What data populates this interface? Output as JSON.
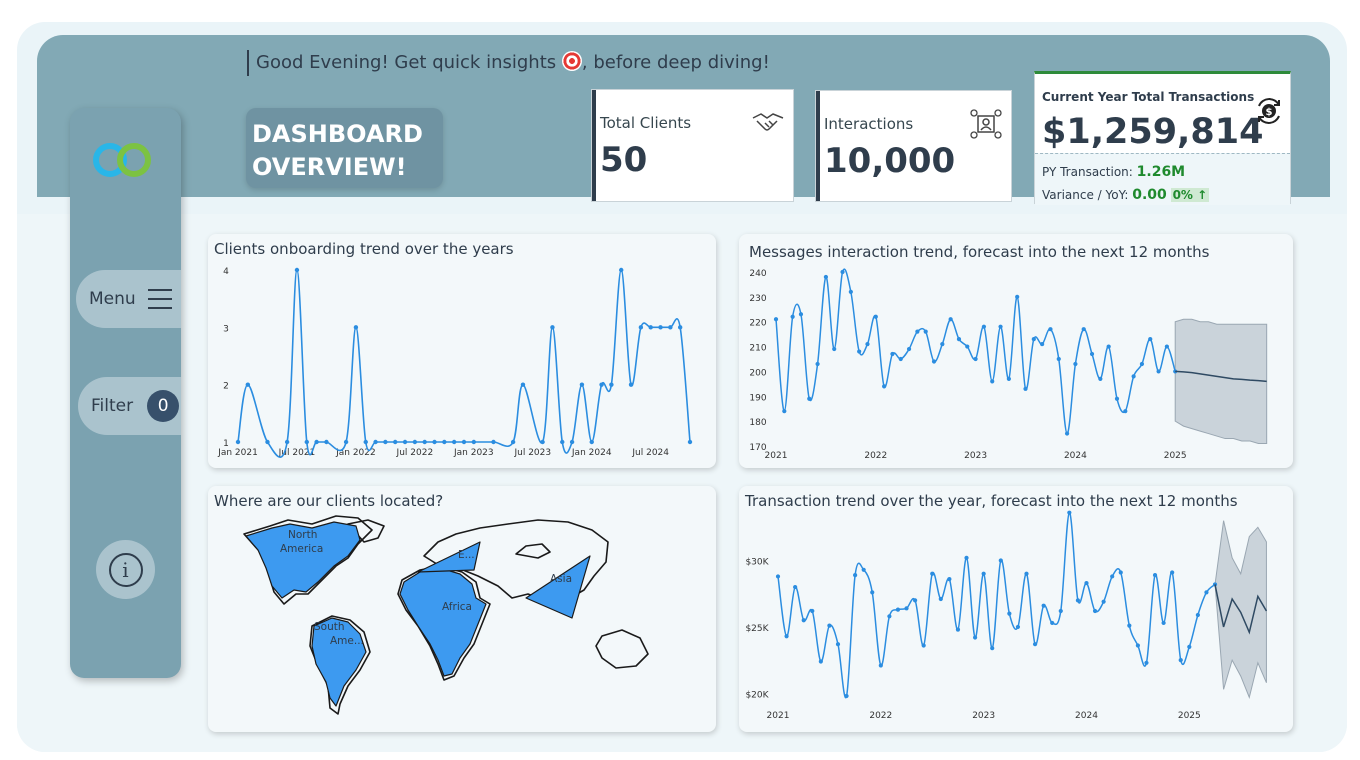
{
  "greeting": {
    "text_before": "Good Evening! Get quick insights",
    "text_after": ", before deep diving!"
  },
  "title": {
    "line1": "DASHBOARD",
    "line2": "OVERVIEW!"
  },
  "sidebar": {
    "menu_label": "Menu",
    "filter_label": "Filter",
    "filter_count": "0",
    "info_glyph": "i"
  },
  "kpis": {
    "clients": {
      "label": "Total Clients",
      "value": "50",
      "icon": "handshake-icon"
    },
    "interactions": {
      "label": "Interactions",
      "value": "10,000",
      "icon": "network-icon"
    },
    "transactions": {
      "label": "Current Year Total Transactions",
      "value": "$1,259,814",
      "icon": "dollar-refresh-icon",
      "py_label": "PY Transaction:",
      "py_value": "1.26M",
      "variance_label": "Variance / YoY:",
      "variance_value": "0.00",
      "variance_pct": "0%"
    }
  },
  "colors": {
    "header": "#82a9b5",
    "sidebar": "#7ba2b0",
    "line": "#2b8de0",
    "forecast": "#2f4a63",
    "map_fill": "#3d9af0",
    "accent_green": "#1f8a2e",
    "dark_text": "#2f3d4c"
  },
  "chart_data": [
    {
      "type": "line",
      "title": "Clients onboarding trend over the years",
      "x": [
        "2021-01",
        "2021-02",
        "2021-04",
        "2021-06",
        "2021-07",
        "2021-08",
        "2021-09",
        "2021-10",
        "2021-12",
        "2022-01",
        "2022-02",
        "2022-03",
        "2022-04",
        "2022-05",
        "2022-06",
        "2022-07",
        "2022-08",
        "2022-09",
        "2022-10",
        "2022-11",
        "2022-12",
        "2023-01",
        "2023-03",
        "2023-05",
        "2023-06",
        "2023-08",
        "2023-09",
        "2023-10",
        "2023-11",
        "2023-12",
        "2024-01",
        "2024-02",
        "2024-03",
        "2024-04",
        "2024-05",
        "2024-06",
        "2024-07",
        "2024-08",
        "2024-09",
        "2024-10",
        "2024-11"
      ],
      "values": [
        1,
        2,
        1,
        1,
        4,
        1,
        1,
        1,
        1,
        3,
        1,
        1,
        1,
        1,
        1,
        1,
        1,
        1,
        1,
        1,
        1,
        1,
        1,
        1,
        2,
        1,
        3,
        1,
        1,
        2,
        1,
        2,
        2,
        4,
        2,
        3,
        3,
        3,
        3,
        3,
        1
      ],
      "x_ticks": [
        "Jan 2021",
        "Jul 2021",
        "Jan 2022",
        "Jul 2022",
        "Jan 2023",
        "Jul 2023",
        "Jan 2024",
        "Jul 2024"
      ],
      "y_ticks": [
        "1",
        "2",
        "3",
        "4"
      ],
      "ylim": [
        1,
        4
      ]
    },
    {
      "type": "line",
      "title": "Messages interaction trend, forecast into the next 12 months",
      "x_ticks": [
        "2021",
        "2022",
        "2023",
        "2024",
        "2025"
      ],
      "y_ticks": [
        "170",
        "180",
        "190",
        "200",
        "210",
        "220",
        "230",
        "240"
      ],
      "ylim": [
        170,
        240
      ],
      "actual": [
        221,
        184,
        222,
        223,
        189,
        203,
        238,
        209,
        240,
        232,
        208,
        211,
        222,
        194,
        207,
        205,
        209,
        216,
        216,
        204,
        211,
        221,
        213,
        210,
        205,
        218,
        196,
        218,
        197,
        230,
        193,
        213,
        211,
        217,
        205,
        175,
        203,
        217,
        207,
        197,
        210,
        189,
        184,
        198,
        203,
        213,
        200,
        210,
        200
      ],
      "forecast": {
        "values": [
          200,
          199.8,
          199.5,
          199,
          198.5,
          198,
          197.5,
          197,
          196.8,
          196.5,
          196.3,
          196
        ],
        "upper": [
          220,
          221,
          221,
          220,
          220,
          219,
          219,
          219,
          219,
          219,
          219,
          219
        ],
        "lower": [
          180,
          178,
          177,
          176,
          175,
          174,
          173,
          173,
          172,
          172,
          171,
          171
        ]
      }
    },
    {
      "type": "map",
      "title": "Where are our clients located?",
      "regions": [
        "North America",
        "South America",
        "Europe",
        "Africa",
        "Asia"
      ],
      "region_labels": [
        "North America",
        "South Ame...",
        "E...",
        "Africa",
        "Asia"
      ]
    },
    {
      "type": "line",
      "title": "Transaction trend over the year, forecast into the next 12 months",
      "x_ticks": [
        "2021",
        "2022",
        "2023",
        "2024",
        "2025"
      ],
      "y_ticks": [
        "$20K",
        "$25K",
        "$30K"
      ],
      "ylim": [
        19500,
        33500
      ],
      "actual": [
        28800,
        24300,
        28000,
        25500,
        26200,
        22400,
        25100,
        23700,
        19800,
        28900,
        29300,
        27600,
        22100,
        25800,
        26300,
        26400,
        27000,
        23600,
        29000,
        27100,
        28600,
        24800,
        30200,
        24200,
        29000,
        23400,
        30000,
        26000,
        25000,
        29000,
        23700,
        26600,
        25300,
        26200,
        33600,
        27000,
        28300,
        26200,
        26900,
        28800,
        29100,
        25100,
        23600,
        22300,
        28900,
        25300,
        29100,
        22500,
        23500,
        25900,
        27600,
        28200
      ],
      "forecast": {
        "values": [
          28200,
          25000,
          27100,
          26100,
          24600,
          27300,
          26200
        ],
        "upper": [
          28200,
          33000,
          30200,
          29000,
          31800,
          32500,
          31400
        ],
        "lower": [
          28200,
          20300,
          22500,
          21300,
          19700,
          22300,
          20800
        ]
      }
    }
  ]
}
